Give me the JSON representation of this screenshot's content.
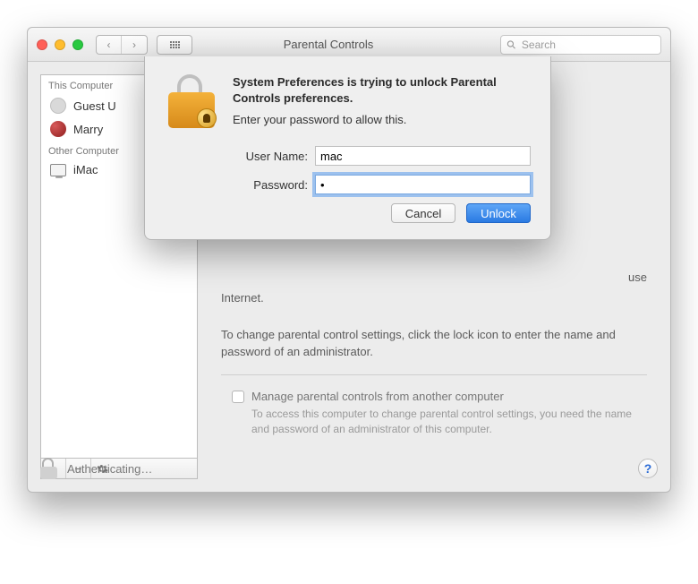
{
  "window": {
    "title": "Parental Controls",
    "search_placeholder": "Search"
  },
  "sidebar": {
    "groups": [
      {
        "header": "This Computer",
        "items": [
          {
            "label": "Guest U",
            "icon": "avatar-gray"
          },
          {
            "label": "Marry",
            "icon": "avatar-red"
          }
        ]
      },
      {
        "header": "Other Computer",
        "items": [
          {
            "label": "iMac",
            "icon": "monitor"
          }
        ]
      }
    ],
    "footer": {
      "add": "+",
      "remove": "−",
      "gear": "✻"
    }
  },
  "main": {
    "fragment_line": "use",
    "fragment_line2": "Internet.",
    "p2": "To change parental control settings, click the lock icon to enter the name and password of an administrator.",
    "checkbox_label": "Manage parental controls from another computer",
    "checkbox_sub": "To access this computer to change parental control settings, you need the name and password of an administrator of this computer."
  },
  "auth": {
    "label": "Authenticating…",
    "help": "?"
  },
  "sheet": {
    "heading": "System Preferences is trying to unlock Parental Controls preferences.",
    "sub": "Enter your password to allow this.",
    "user_label": "User Name:",
    "user_value": "mac",
    "pass_label": "Password:",
    "pass_value": "•",
    "cancel": "Cancel",
    "unlock": "Unlock"
  }
}
